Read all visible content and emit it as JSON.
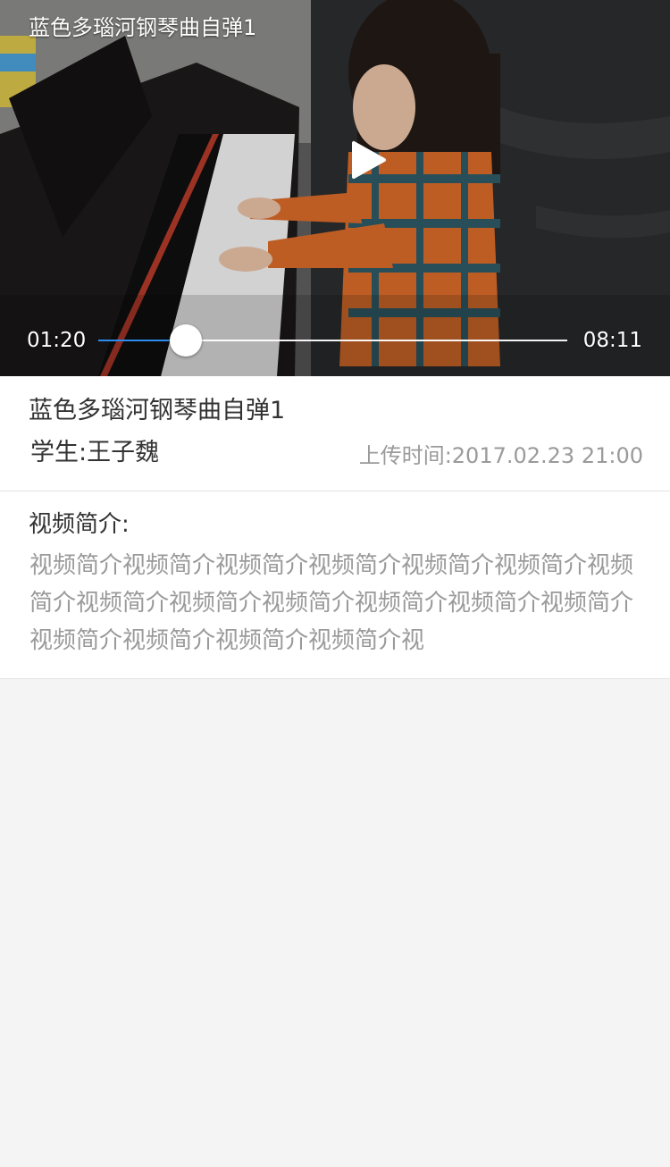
{
  "player": {
    "title": "蓝色多瑙河钢琴曲自弹1",
    "current_time": "01:20",
    "total_time": "08:11",
    "progress_fraction": 0.187
  },
  "info": {
    "title": "蓝色多瑙河钢琴曲自弹1",
    "student": "学生:王子魏",
    "upload_time": "上传时间:2017.02.23  21:00"
  },
  "description": {
    "label": "视频简介:",
    "text": "视频简介视频简介视频简介视频简介视频简介视频简介视频简介视频简介视频简介视频简介视频简介视频简介视频简介视频简介视频简介视频简介视频简介视"
  },
  "colors": {
    "progress_played": "#2d8cf0",
    "background": "#f4f4f4"
  }
}
